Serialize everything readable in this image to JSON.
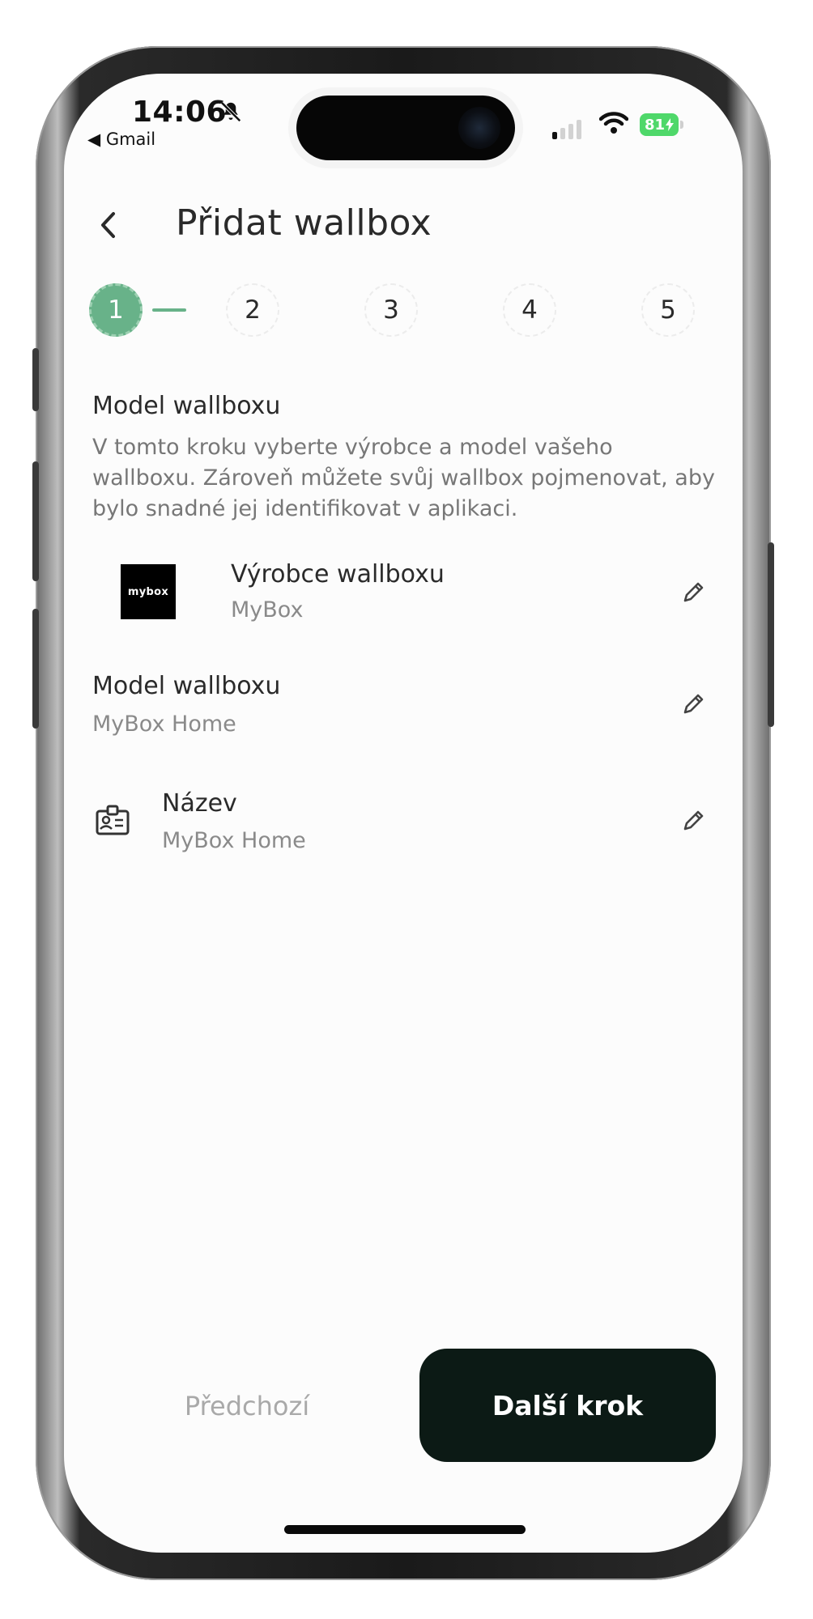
{
  "status_bar": {
    "time": "14:06",
    "back_app": "◀ Gmail",
    "battery": "81",
    "bell_icon": "bell-slash-icon",
    "wifi_icon": "wifi-icon",
    "signal_icon": "cellular-signal-icon"
  },
  "header": {
    "back_icon": "chevron-left-icon",
    "title": "Přidat wallbox"
  },
  "stepper": {
    "steps": [
      "1",
      "2",
      "3",
      "4",
      "5"
    ],
    "active_step": 1,
    "accent_color": "#68b289"
  },
  "section": {
    "title": "Model wallboxu",
    "description": "V tomto kroku vyberte výrobce a model vašeho wallboxu. Zároveň můžete svůj wallbox pojmenovat, aby bylo snadné jej identifikovat v aplikaci."
  },
  "fields": {
    "manufacturer": {
      "label": "Výrobce wallboxu",
      "value": "MyBox",
      "logo_text": "mybox",
      "edit_icon": "pencil-icon"
    },
    "model": {
      "label": "Model wallboxu",
      "value": "MyBox Home",
      "edit_icon": "pencil-icon"
    },
    "name": {
      "label": "Název",
      "value": "MyBox Home",
      "icon": "id-badge-icon",
      "edit_icon": "pencil-icon"
    }
  },
  "footer": {
    "prev_label": "Předchozí",
    "next_label": "Další krok",
    "next_color": "#0c1a15"
  }
}
